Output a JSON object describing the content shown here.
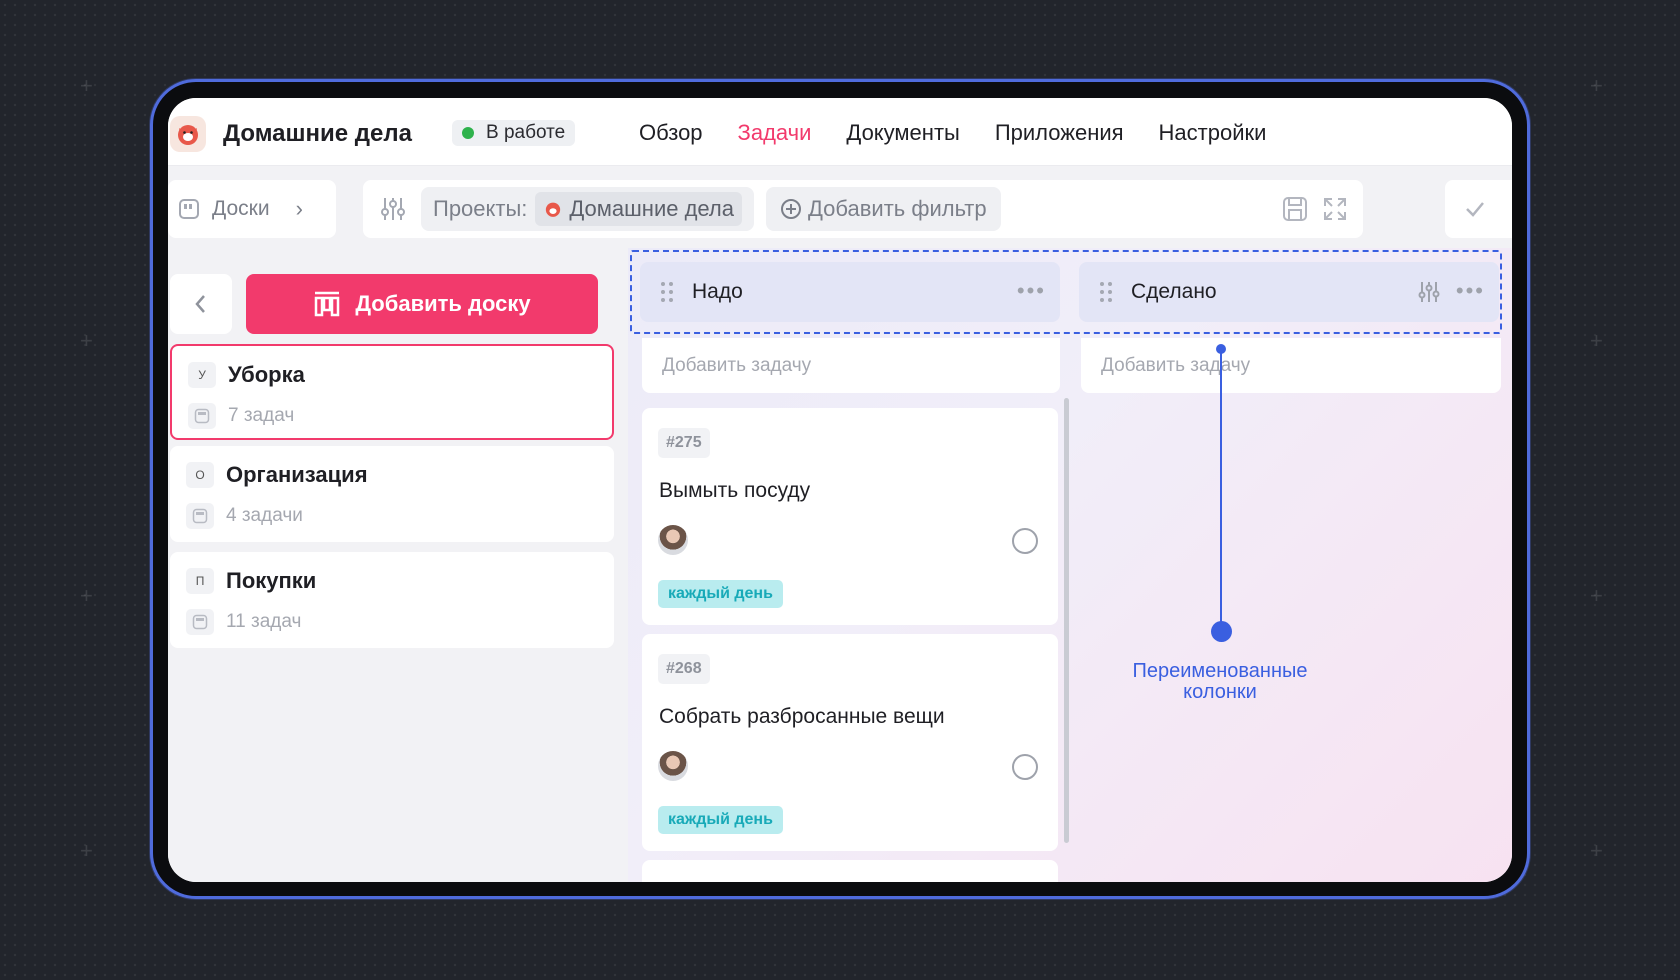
{
  "header": {
    "project_title": "Домашние дела",
    "status_label": "В работе",
    "status_color": "#2eb24c",
    "nav": [
      {
        "label": "Обзор",
        "active": false
      },
      {
        "label": "Задачи",
        "active": true
      },
      {
        "label": "Документы",
        "active": false
      },
      {
        "label": "Приложения",
        "active": false
      },
      {
        "label": "Настройки",
        "active": false
      }
    ]
  },
  "toolbar": {
    "boards_label": "Доски",
    "projects_label": "Проекты:",
    "projects_value": "Домашние дела",
    "add_filter_label": "Добавить фильтр"
  },
  "sidebar": {
    "add_board_label": "Добавить доску",
    "boards": [
      {
        "letter": "У",
        "name": "Уборка",
        "count": "7 задач",
        "selected": true
      },
      {
        "letter": "О",
        "name": "Организация",
        "count": "4 задачи",
        "selected": false
      },
      {
        "letter": "П",
        "name": "Покупки",
        "count": "11 задач",
        "selected": false
      }
    ]
  },
  "kanban": {
    "columns": [
      {
        "title": "Надо",
        "add_task_label": "Добавить задачу",
        "tasks": [
          {
            "id": "#275",
            "title": "Вымыть посуду",
            "tag": "каждый день"
          },
          {
            "id": "#268",
            "title": "Собрать разбросанные вещи",
            "tag": "каждый день"
          }
        ]
      },
      {
        "title": "Сделано",
        "add_task_label": "Добавить задачу",
        "tasks": []
      }
    ]
  },
  "annotation": {
    "line1": "Переименованные",
    "line2": "колонки",
    "color": "#3a5fe0"
  },
  "colors": {
    "accent": "#f23a6c",
    "frame": "#4f6bdc",
    "tag_bg": "#b9ecef",
    "tag_text": "#18aab8"
  }
}
